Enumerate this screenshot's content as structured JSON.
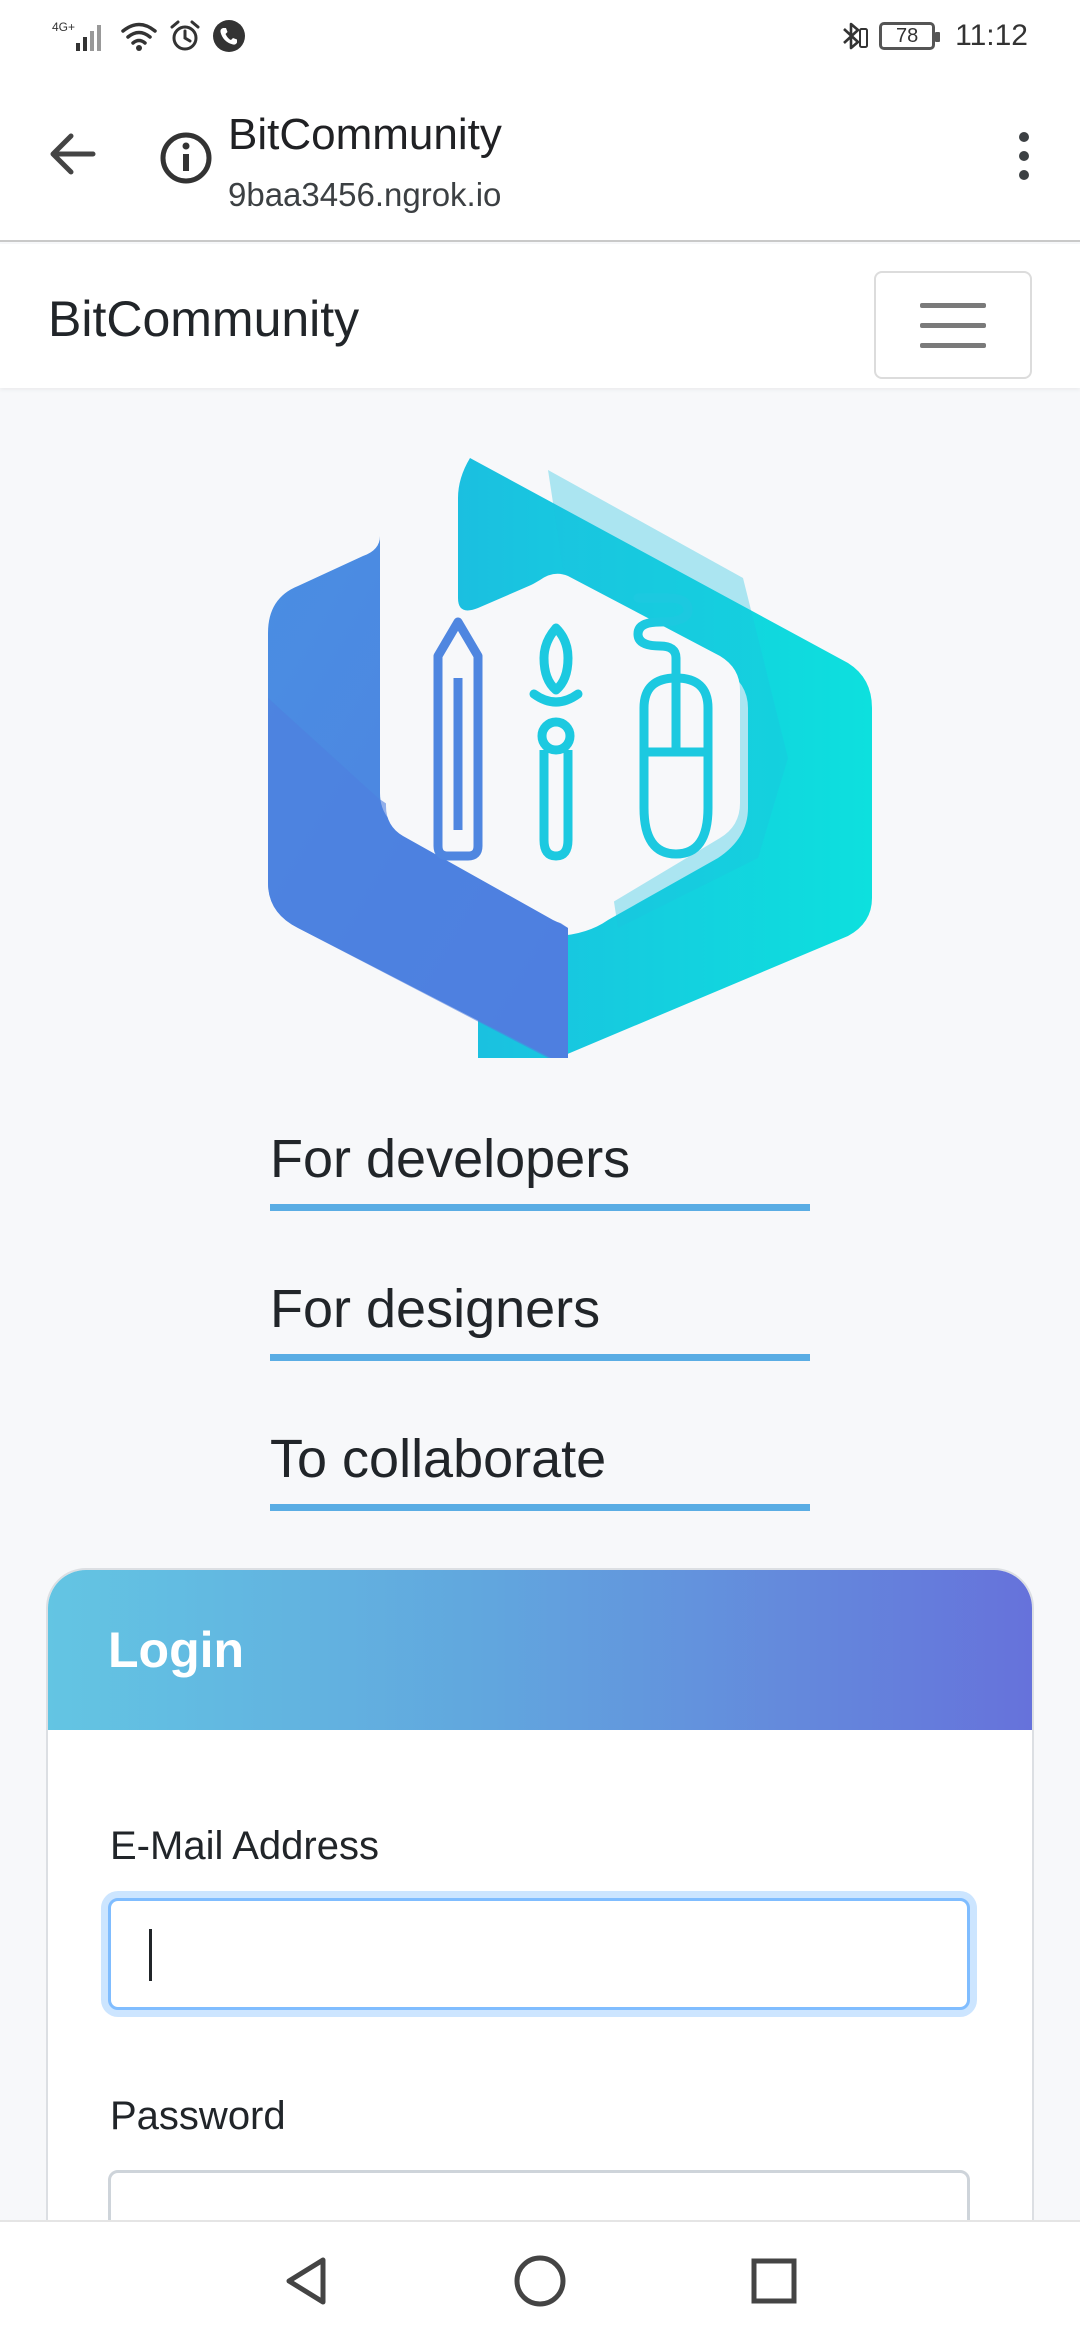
{
  "status_bar": {
    "network": "4G+",
    "battery": "78",
    "time": "11:12"
  },
  "browser": {
    "page_title": "BitCommunity",
    "url": "9baa3456.ngrok.io"
  },
  "navbar": {
    "brand": "BitCommunity"
  },
  "taglines": [
    "For developers",
    "For designers",
    "To collaborate"
  ],
  "login": {
    "title": "Login",
    "email_label": "E-Mail Address",
    "email_value": "",
    "password_label": "Password",
    "password_value": ""
  },
  "colors": {
    "accent_underline": "#5aade4",
    "header_gradient_start": "#63c5e3",
    "header_gradient_end": "#6672db",
    "logo_blue": "#4f86e0",
    "logo_cyan": "#1cc9e0"
  },
  "icons": [
    "signal-icon",
    "wifi-icon",
    "alarm-icon",
    "phone-icon",
    "bluetooth-icon",
    "battery-icon",
    "back-arrow-icon",
    "info-icon",
    "more-vert-icon",
    "hamburger-icon",
    "pencil-icon",
    "paintbrush-icon",
    "mouse-icon",
    "nav-back-icon",
    "nav-home-icon",
    "nav-recents-icon"
  ]
}
